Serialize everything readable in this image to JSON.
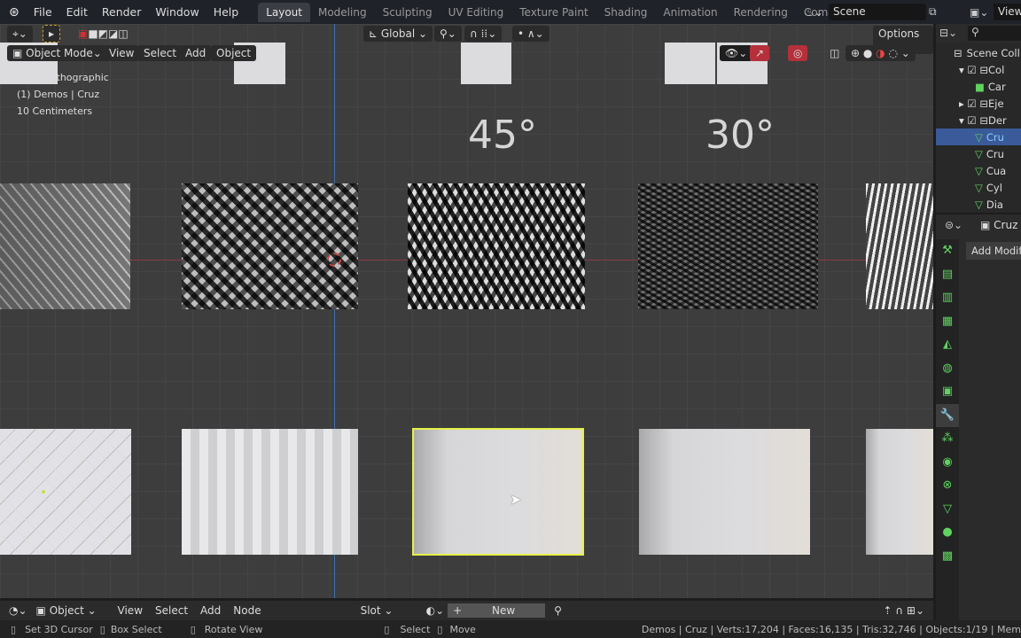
{
  "topbar": {
    "menus": [
      "File",
      "Edit",
      "Render",
      "Window",
      "Help"
    ],
    "workspaces": [
      "Layout",
      "Modeling",
      "Sculpting",
      "UV Editing",
      "Texture Paint",
      "Shading",
      "Animation",
      "Rendering",
      "Compositing"
    ],
    "active_workspace": "Layout",
    "scene": "Scene",
    "view_label": "View"
  },
  "viewport": {
    "transform_orientation": "Global",
    "options_label": "Options",
    "mode": "Object Mode",
    "menus": [
      "View",
      "Select",
      "Add",
      "Object"
    ],
    "overlay_text": [
      "Front Orthographic",
      "(1) Demos | Cruz",
      "10 Centimeters"
    ],
    "labels": [
      "45°",
      "30°"
    ]
  },
  "outliner": {
    "items": [
      {
        "label": "Scene Coll",
        "type": "scene"
      },
      {
        "label": "Col",
        "type": "collection"
      },
      {
        "label": "Car",
        "type": "camera"
      },
      {
        "label": "Eje",
        "type": "collection"
      },
      {
        "label": "Der",
        "type": "collection"
      },
      {
        "label": "Cru",
        "type": "mesh",
        "selected": true
      },
      {
        "label": "Cru",
        "type": "mesh"
      },
      {
        "label": "Cua",
        "type": "mesh"
      },
      {
        "label": "Cyl",
        "type": "mesh"
      },
      {
        "label": "Dia",
        "type": "mesh"
      }
    ]
  },
  "properties": {
    "object_name": "Cruz",
    "add_modifier": "Add Modifi"
  },
  "node_editor": {
    "object_label": "Object",
    "menus": [
      "View",
      "Select",
      "Add",
      "Node"
    ],
    "slot": "Slot",
    "new_label": "New"
  },
  "status": {
    "items": [
      "Set 3D Cursor",
      "Box Select",
      "Rotate View",
      "Select",
      "Move"
    ],
    "info": "Demos | Cruz | Verts:17,204 | Faces:16,135 | Tris:32,746 | Objects:1/19 | Mem"
  },
  "colors": {
    "selection_outline": "#e6f04a",
    "x_axis": "#b04050",
    "z_axis": "#3b6fb0",
    "outliner_highlight": "#3a5a9a",
    "mesh_icon": "#5fd35f"
  }
}
